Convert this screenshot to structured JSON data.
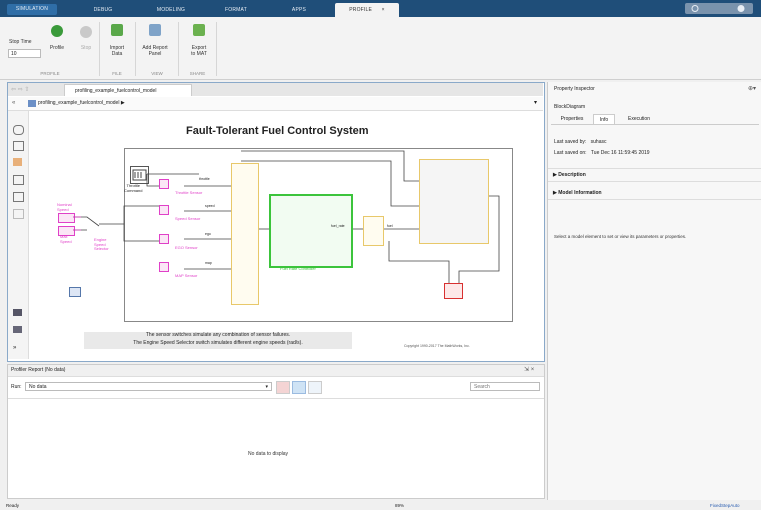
{
  "toolstrip": {
    "tabs": [
      "SIMULATION",
      "DEBUG",
      "MODELING",
      "FORMAT",
      "APPS",
      "PROFILE"
    ],
    "active_tab": "PROFILE",
    "close_glyph": "×"
  },
  "ribbon": {
    "stop_time_label": "Stop Time",
    "stop_time_value": "10",
    "buttons": {
      "profile": "Profile",
      "stop": "Stop",
      "import_data": [
        "Import",
        "Data"
      ],
      "add_report_panel": [
        "Add Report",
        "Panel"
      ],
      "export_to_mat": [
        "Export",
        "to MAT"
      ]
    },
    "groups": [
      "PROFILE",
      "FILE",
      "VIEW",
      "SHARE"
    ]
  },
  "editor": {
    "tab_label": "profiling_example_fuelcontrol_model",
    "breadcrumb": "profiling_example_fuelcontrol_model ▶",
    "diagram": {
      "title": "Fault-Tolerant Fuel Control System",
      "throttle_command": [
        "Throttle",
        "Command"
      ],
      "nominal_speed": [
        "Nominal",
        "Speed"
      ],
      "max_speed": [
        "Max",
        "Speed"
      ],
      "engine_speed_selector": [
        "Engine",
        "Speed",
        "Selector"
      ],
      "sensor_blocks": [
        "Throttle Sensor",
        "Speed Sensor",
        "EGO Sensor",
        "MAP Sensor"
      ],
      "sensor_ports": [
        "throttle",
        "speed",
        "ego",
        "map"
      ],
      "fuel_rate_controller": "Fuel Rate Controller",
      "port_labels": [
        "fuel_rate",
        "fuel"
      ],
      "note_line1": "The sensor switches simulate any combination of sensor failures.",
      "note_line2": "The Engine Speed Selector switch simulates different engine speeds (rad/s).",
      "copyright": "Copyright 1990-2017 The MathWorks, Inc."
    }
  },
  "profiler": {
    "title": "Profiler Report (No data)",
    "run_label": "Run:",
    "run_value": "No data",
    "search_placeholder": "Search",
    "empty_message": "No data to display"
  },
  "property_inspector": {
    "title": "Property Inspector",
    "object": "BlockDiagram",
    "tabs": [
      "Properties",
      "Info",
      "Execution"
    ],
    "active_tab": "Info",
    "last_saved_by_label": "Last saved by:",
    "last_saved_by": "suhasc",
    "last_saved_on_label": "Last saved on:",
    "last_saved_on": "Tue Dec 16 11:59:45 2019",
    "sections": [
      "Description",
      "Model Information"
    ],
    "hint": "Select a model element to set or view its parameters or properties."
  },
  "status_bar": {
    "left": "Ready",
    "zoom": "89%",
    "solver": "FixedStepAuto"
  },
  "colors": {
    "tabstrip": "#1f4e79",
    "sensor_magenta": "#e040c8",
    "controller_green": "#3cc43c",
    "bus_yellow": "#e8c86a",
    "error_red": "#d83030"
  }
}
